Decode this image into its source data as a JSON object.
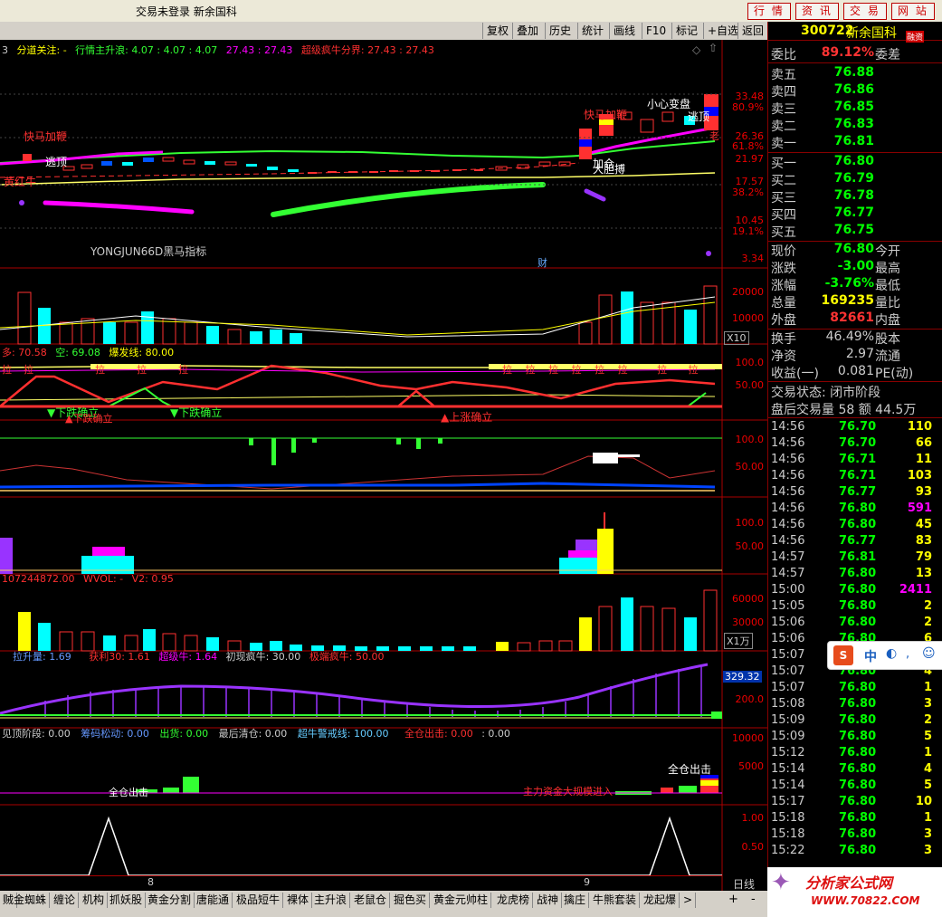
{
  "window": {
    "title": "交易未登录  新余国科",
    "top_buttons": [
      "行 情",
      "资 讯",
      "交 易",
      "网 站"
    ]
  },
  "toolbar": [
    "复权",
    "叠加",
    "历史",
    "统计",
    "画线",
    "F10",
    "标记",
    "+自选",
    "返回"
  ],
  "main": {
    "title_prefix": "3",
    "title_parts": [
      "分道关注: -",
      "行情主升浪: 4.07 : 4.07 : 4.07",
      "27.43 : 27.43",
      "超级疯牛分界: 27.43 : 27.43"
    ],
    "axis": [
      "33.48",
      "80.9%",
      "26.36",
      "61.8%",
      "21.97",
      "17.57",
      "38.2%",
      "10.45",
      "19.1%",
      "3.34"
    ],
    "labels": [
      "快马加鞭",
      "逃顶",
      "黄红牛",
      "快马加鞭",
      "小心变盘",
      "逃顶",
      "老",
      "加仓",
      "大胆搏",
      "YONGJUN66D黑马指标",
      "财"
    ]
  },
  "vol1": {
    "axis": [
      "20000",
      "10000"
    ],
    "tag": "X10"
  },
  "pane3": {
    "title": [
      "多: 70.58",
      "空: 69.08",
      "爆发线: 80.00"
    ],
    "axis": [
      "100.0",
      "50.00"
    ],
    "labels": [
      "下跌确立",
      "下跌确立",
      "下跌确立",
      "上涨确立"
    ],
    "marks": [
      "拉",
      "拉",
      "拉",
      "拉",
      "拉",
      "拉",
      "拉",
      "拉",
      "拉",
      "拉",
      "拉",
      "拉",
      "拉",
      "拉"
    ]
  },
  "pane4": {
    "axis": [
      "100.0",
      "50.00"
    ]
  },
  "pane5": {
    "axis": [
      "100.0",
      "50.00"
    ]
  },
  "pane6": {
    "title": [
      "107244872.00",
      "WVOL: -",
      "V2: 0.95"
    ],
    "axis": [
      "60000",
      "30000"
    ],
    "tag": "X1万"
  },
  "pane7": {
    "title": [
      "拉升量: 1.69",
      "获利30: 1.61",
      "超级牛: 1.64",
      "初现疯牛: 30.00",
      "极端疯牛: 50.00"
    ],
    "axis": [
      "329.32",
      "200.0"
    ]
  },
  "pane8": {
    "title": [
      "见顶阶段: 0.00",
      "筹码松动: 0.00",
      "出货: 0.00",
      "最后清仓: 0.00",
      "超牛警戒线: 100.00",
      "全仓出击: 0.00",
      ": 0.00"
    ],
    "axis": [
      "10000",
      "5000"
    ],
    "labels": [
      "全仓出击",
      "主力资金大规模进入",
      "全仓出击"
    ]
  },
  "pane9": {
    "axis": [
      "1.00",
      "0.50"
    ],
    "xticks": [
      "8",
      "9"
    ],
    "corner": "日线"
  },
  "quote": {
    "code": "300722",
    "name": "新余国科",
    "badge": "融资",
    "weibi_label": "委比",
    "weibi": "89.12%",
    "weicha_label": "委差",
    "asks": [
      {
        "l": "卖五",
        "p": "76.88"
      },
      {
        "l": "卖四",
        "p": "76.86"
      },
      {
        "l": "卖三",
        "p": "76.85"
      },
      {
        "l": "卖二",
        "p": "76.83"
      },
      {
        "l": "卖一",
        "p": "76.81"
      }
    ],
    "bids": [
      {
        "l": "买一",
        "p": "76.80"
      },
      {
        "l": "买二",
        "p": "76.79"
      },
      {
        "l": "买三",
        "p": "76.78"
      },
      {
        "l": "买四",
        "p": "76.77"
      },
      {
        "l": "买五",
        "p": "76.75"
      }
    ],
    "stats": [
      {
        "l": "现价",
        "v": "76.80",
        "c": "#0f0",
        "l2": "今开"
      },
      {
        "l": "涨跌",
        "v": "-3.00",
        "c": "#0f0",
        "l2": "最高"
      },
      {
        "l": "涨幅",
        "v": "-3.76%",
        "c": "#0f0",
        "l2": "最低"
      },
      {
        "l": "总量",
        "v": "169235",
        "c": "#ff0",
        "l2": "量比"
      },
      {
        "l": "外盘",
        "v": "82661",
        "c": "#f00",
        "l2": "内盘"
      }
    ],
    "stats2": [
      {
        "l": "换手",
        "v": "46.49%",
        "l2": "股本"
      },
      {
        "l": "净资",
        "v": "2.97",
        "l2": "流通"
      },
      {
        "l": "收益(一)",
        "v": "0.081",
        "l2": "PE(动)"
      }
    ],
    "trade_state": "交易状态: 闭市阶段",
    "after_hours": "盘后交易量 58 额 44.5万",
    "ticks": [
      {
        "t": "14:56",
        "p": "76.70",
        "v": "110",
        "c": "#ff0"
      },
      {
        "t": "14:56",
        "p": "76.70",
        "v": "66",
        "c": "#ff0"
      },
      {
        "t": "14:56",
        "p": "76.71",
        "v": "11",
        "c": "#ff0"
      },
      {
        "t": "14:56",
        "p": "76.71",
        "v": "103",
        "c": "#ff0"
      },
      {
        "t": "14:56",
        "p": "76.77",
        "v": "93",
        "c": "#ff0"
      },
      {
        "t": "14:56",
        "p": "76.80",
        "v": "591",
        "c": "#f0f"
      },
      {
        "t": "14:56",
        "p": "76.80",
        "v": "45",
        "c": "#ff0"
      },
      {
        "t": "14:56",
        "p": "76.77",
        "v": "83",
        "c": "#ff0"
      },
      {
        "t": "14:57",
        "p": "76.81",
        "v": "79",
        "c": "#ff0"
      },
      {
        "t": "14:57",
        "p": "76.80",
        "v": "13",
        "c": "#ff0"
      },
      {
        "t": "15:00",
        "p": "76.80",
        "v": "2411",
        "c": "#f0f"
      },
      {
        "t": "15:05",
        "p": "76.80",
        "v": "2",
        "c": "#ff0"
      },
      {
        "t": "15:06",
        "p": "76.80",
        "v": "2",
        "c": "#ff0"
      },
      {
        "t": "15:06",
        "p": "76.80",
        "v": "6",
        "c": "#ff0"
      },
      {
        "t": "15:07",
        "p": "76.80",
        "v": "3",
        "c": "#ff0"
      },
      {
        "t": "15:07",
        "p": "76.80",
        "v": "4",
        "c": "#ff0"
      },
      {
        "t": "15:07",
        "p": "76.80",
        "v": "1",
        "c": "#ff0"
      },
      {
        "t": "15:08",
        "p": "76.80",
        "v": "3",
        "c": "#ff0"
      },
      {
        "t": "15:09",
        "p": "76.80",
        "v": "2",
        "c": "#ff0"
      },
      {
        "t": "15:09",
        "p": "76.80",
        "v": "5",
        "c": "#ff0"
      },
      {
        "t": "15:12",
        "p": "76.80",
        "v": "1",
        "c": "#ff0"
      },
      {
        "t": "15:14",
        "p": "76.80",
        "v": "4",
        "c": "#ff0"
      },
      {
        "t": "15:14",
        "p": "76.80",
        "v": "5",
        "c": "#ff0"
      },
      {
        "t": "15:17",
        "p": "76.80",
        "v": "10",
        "c": "#ff0"
      },
      {
        "t": "15:18",
        "p": "76.80",
        "v": "1",
        "c": "#ff0"
      },
      {
        "t": "15:18",
        "p": "76.80",
        "v": "3",
        "c": "#ff0"
      },
      {
        "t": "15:22",
        "p": "76.80",
        "v": "3",
        "c": "#ff0"
      }
    ]
  },
  "tabs": [
    "贼",
    "金蜘蛛",
    "缠论",
    "机构",
    "抓妖股",
    "黄金分割",
    "唐能通",
    "极品短牛",
    "裸体",
    "主升浪",
    "老鼠仓",
    "掘色买",
    "黄金元帅柱",
    "龙虎榜",
    "战神",
    "擒庄",
    "牛熊套装",
    "龙起爆",
    ">"
  ],
  "tab_right": [
    "+",
    "-"
  ],
  "ime": {
    "mark": "S",
    "lang": "中"
  },
  "watermark": {
    "line1": "分析家公式网",
    "line2": "WWW.70822.COM"
  },
  "colors": {
    "up": "#ff3030",
    "down": "#00ffff",
    "ma_magenta": "#ff00ff",
    "ma_green": "#33ff33",
    "yellow": "#ffff00"
  }
}
